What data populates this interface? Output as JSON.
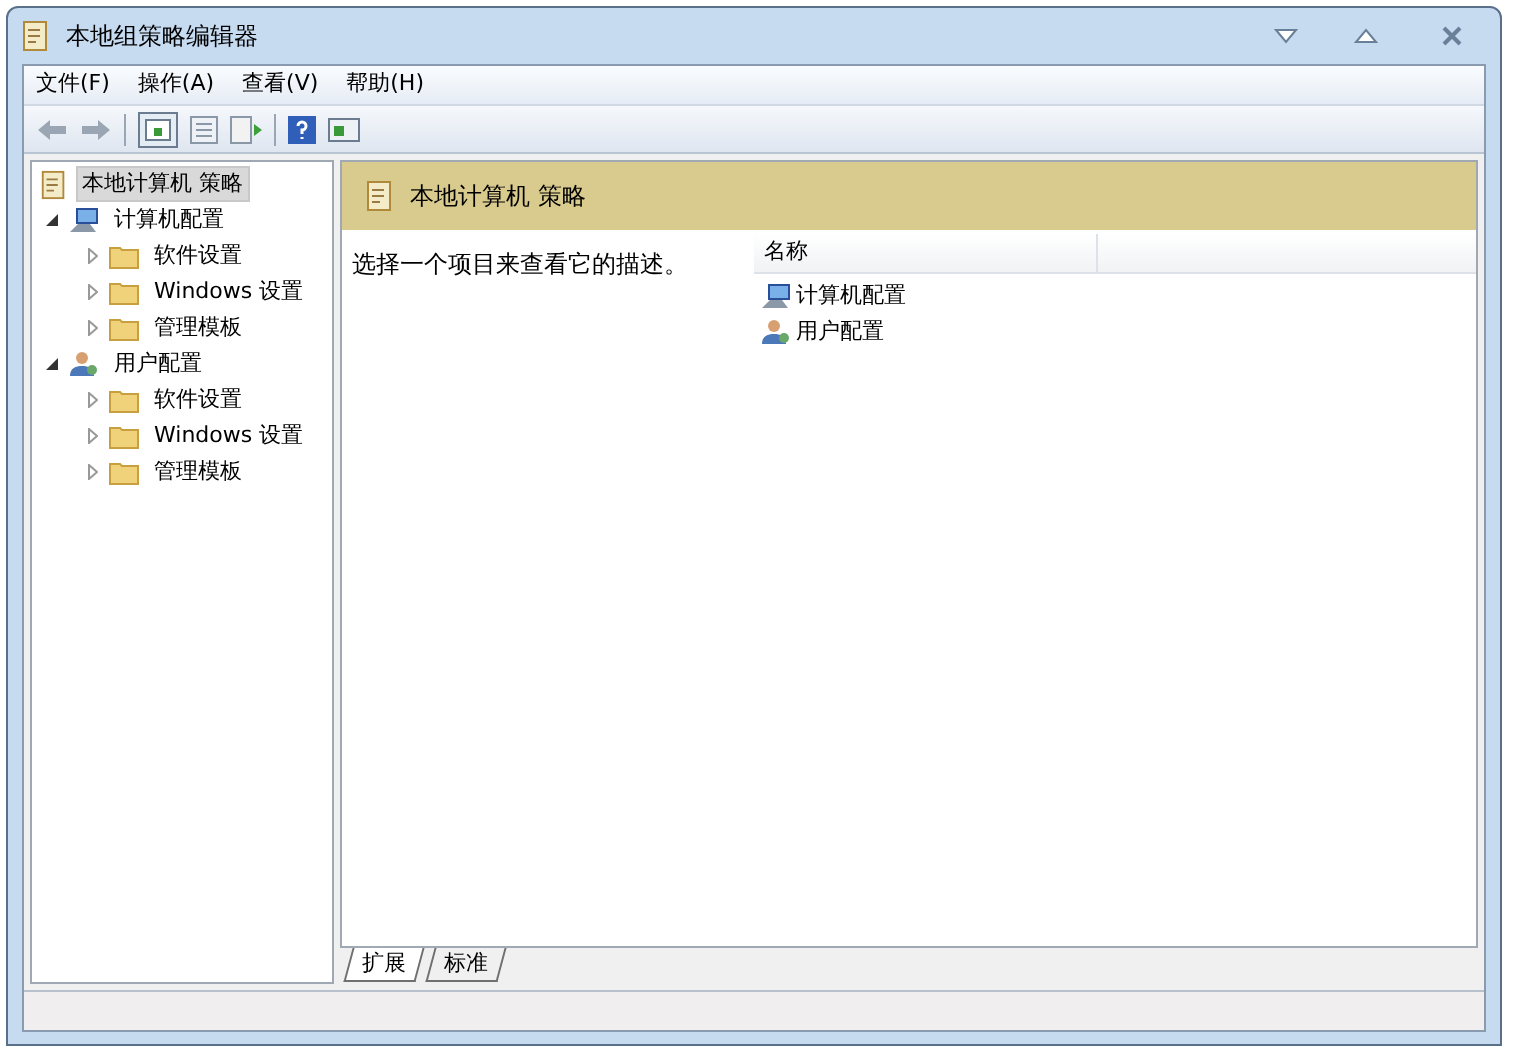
{
  "window": {
    "title": "本地组策略编辑器"
  },
  "menu": [
    "文件(F)",
    "操作(A)",
    "查看(V)",
    "帮助(H)"
  ],
  "tree": [
    {
      "label": "本地计算机 策略",
      "kind": "policy",
      "selected": true,
      "children": [
        {
          "label": "计算机配置",
          "kind": "computer",
          "selected": false,
          "expanded": true,
          "children": [
            {
              "label": "软件设置",
              "kind": "folder",
              "selected": false,
              "expanded": false
            },
            {
              "label": "Windows 设置",
              "kind": "folder",
              "selected": false,
              "expanded": false
            },
            {
              "label": "管理模板",
              "kind": "folder",
              "selected": false,
              "expanded": false
            }
          ]
        },
        {
          "label": "用户配置",
          "kind": "user",
          "selected": false,
          "expanded": true,
          "children": [
            {
              "label": "软件设置",
              "kind": "folder",
              "selected": false,
              "expanded": false
            },
            {
              "label": "Windows 设置",
              "kind": "folder",
              "selected": false,
              "expanded": false
            },
            {
              "label": "管理模板",
              "kind": "folder",
              "selected": false,
              "expanded": false
            }
          ]
        }
      ]
    }
  ],
  "details": {
    "title": "本地计算机 策略",
    "description": "选择一个项目来查看它的描述。",
    "columns": [
      "名称"
    ],
    "items": [
      {
        "label": "计算机配置",
        "kind": "computer"
      },
      {
        "label": "用户配置",
        "kind": "user"
      }
    ]
  },
  "tabs": [
    {
      "label": "扩展",
      "selected": true
    },
    {
      "label": "标准",
      "selected": false
    }
  ]
}
